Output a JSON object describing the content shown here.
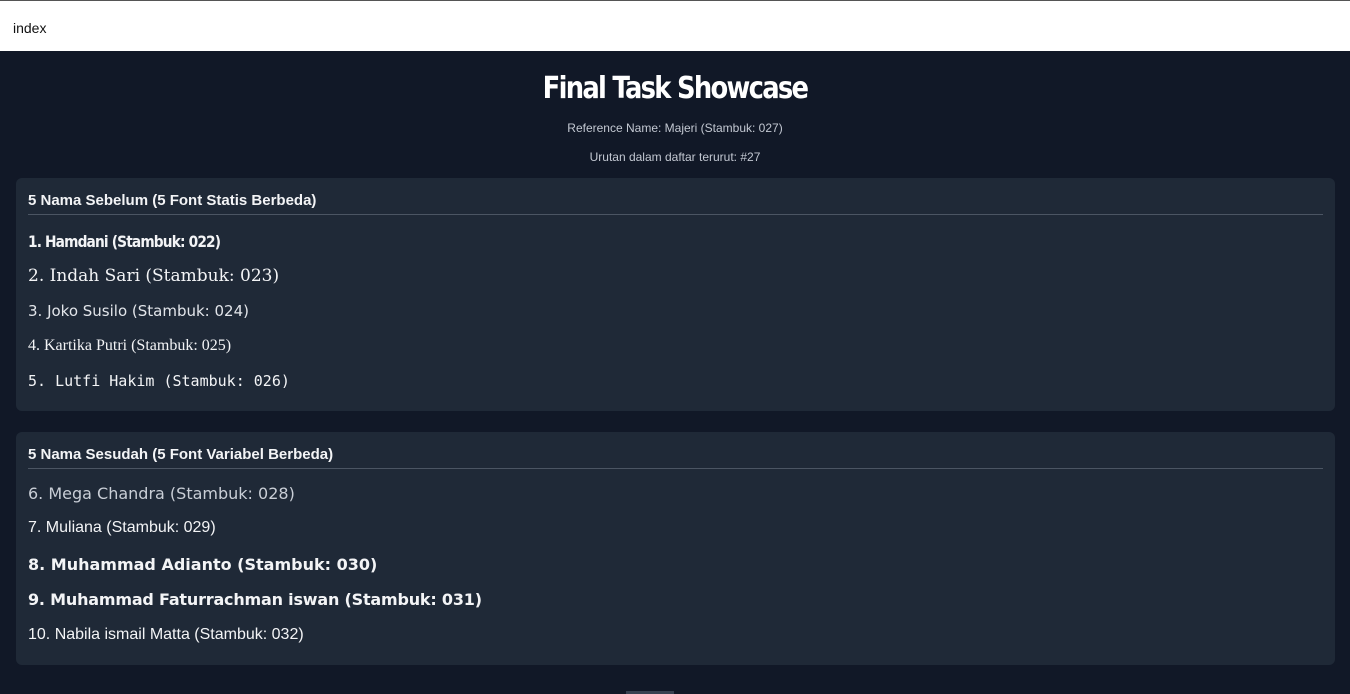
{
  "tab": {
    "title": "index"
  },
  "header": {
    "title": "Final Task Showcase",
    "reference": "Reference Name: Majeri (Stambuk: 027)",
    "order": "Urutan dalam daftar terurut: #27"
  },
  "before": {
    "heading": "5 Nama Sebelum (5 Font Statis Berbeda)",
    "items": [
      "1. Hamdani (Stambuk: 022)",
      "2. Indah Sari (Stambuk: 023)",
      "3. Joko Susilo (Stambuk: 024)",
      "4. Kartika Putri (Stambuk: 025)",
      "5. Lutfi Hakim (Stambuk: 026)"
    ]
  },
  "after": {
    "heading": "5 Nama Sesudah (5 Font Variabel Berbeda)",
    "items": [
      "6. Mega Chandra (Stambuk: 028)",
      "7. Muliana (Stambuk: 029)",
      "8. Muhammad Adianto (Stambuk: 030)",
      "9. Muhammad Faturrachman iswan (Stambuk: 031)",
      "10. Nabila ismail Matta (Stambuk: 032)"
    ]
  }
}
